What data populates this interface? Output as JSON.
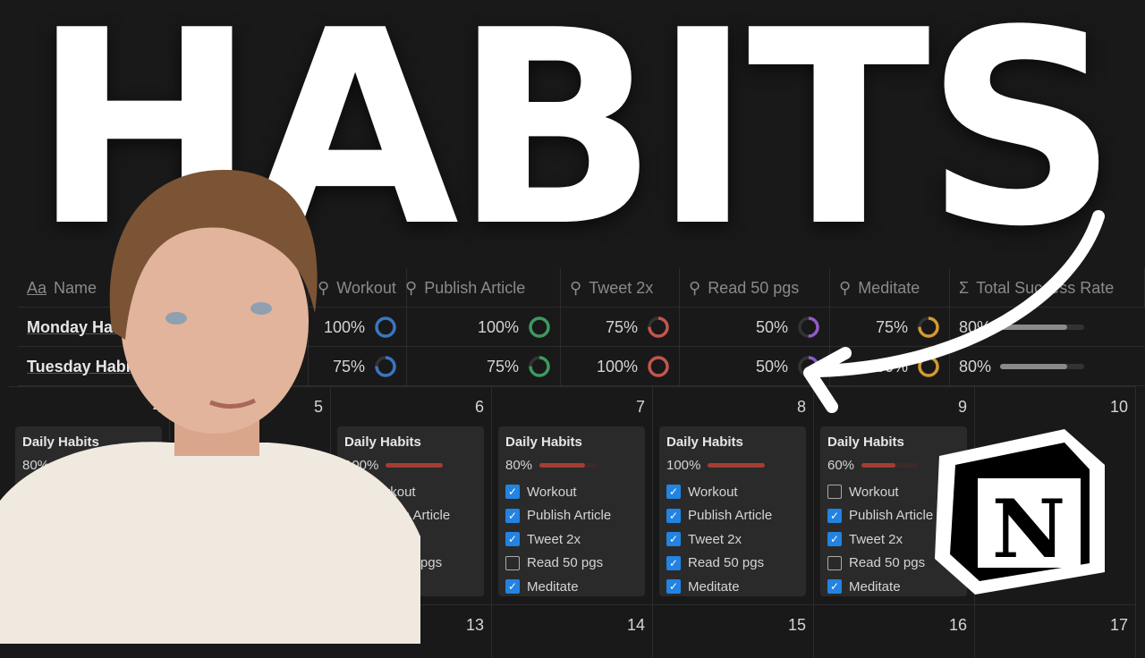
{
  "title": "HABITS",
  "colors": {
    "accent": "#2383e2",
    "workout": "#3a76c0",
    "publish": "#3c9a5f",
    "tweet": "#c4554d",
    "read": "#8e5cc8",
    "meditate": "#d39a2f",
    "bar": "#a33d33"
  },
  "table": {
    "headers": [
      {
        "icon": "text-icon",
        "label": "Name"
      },
      {
        "icon": "search-icon",
        "label": "Workout"
      },
      {
        "icon": "search-icon",
        "label": "Publish Article"
      },
      {
        "icon": "search-icon",
        "label": "Tweet 2x"
      },
      {
        "icon": "search-icon",
        "label": "Read 50 pgs"
      },
      {
        "icon": "search-icon",
        "label": "Meditate"
      },
      {
        "icon": "sigma-icon",
        "label": "Total Success Rate"
      }
    ],
    "rows": [
      {
        "name": "Monday Habits",
        "values": [
          "100%",
          "100%",
          "75%",
          "50%",
          "75%"
        ],
        "total": "80%",
        "total_fraction": 0.8
      },
      {
        "name": "Tuesday Habits",
        "values": [
          "75%",
          "75%",
          "100%",
          "50%",
          "100%"
        ],
        "total": "80%",
        "total_fraction": 0.8
      }
    ]
  },
  "calendar": {
    "week1": [
      "4",
      "5",
      "6",
      "7",
      "8",
      "9",
      "10"
    ],
    "week2": [
      "13",
      "14",
      "15",
      "16",
      "17"
    ],
    "card_title": "Daily Habits",
    "habits": [
      "Workout",
      "Publish Article",
      "Tweet 2x",
      "Read 50 pgs",
      "Meditate"
    ],
    "cards": [
      {
        "day": "4",
        "pct": "80%",
        "fraction": 0.8,
        "checks": [
          true,
          true,
          true,
          false,
          true
        ]
      },
      {
        "day": "6",
        "pct": "100%",
        "fraction": 1,
        "checks": [
          true,
          true,
          true,
          true,
          true
        ]
      },
      {
        "day": "7",
        "pct": "80%",
        "fraction": 0.8,
        "checks": [
          true,
          true,
          true,
          false,
          true
        ]
      },
      {
        "day": "8",
        "pct": "100%",
        "fraction": 1,
        "checks": [
          true,
          true,
          true,
          true,
          true
        ]
      },
      {
        "day": "9",
        "pct": "60%",
        "fraction": 0.6,
        "checks": [
          false,
          true,
          true,
          false,
          true
        ]
      }
    ]
  },
  "logo": "N"
}
